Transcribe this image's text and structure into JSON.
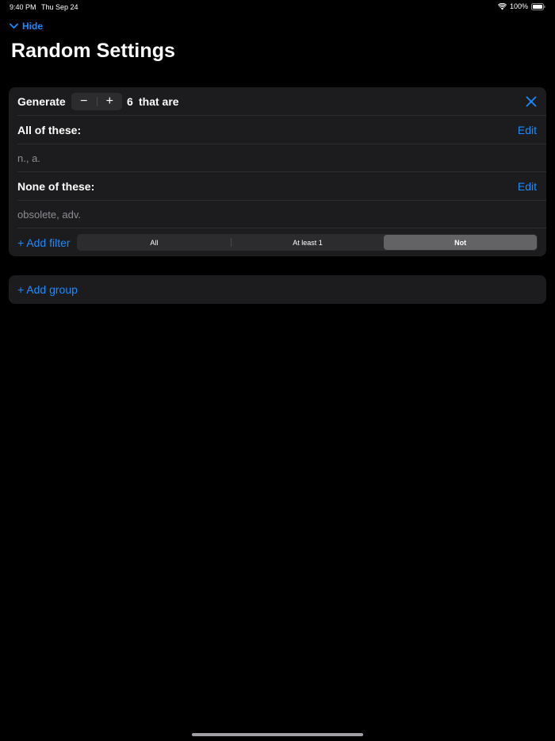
{
  "status_bar": {
    "time": "9:40 PM",
    "date": "Thu Sep 24",
    "battery": "100%"
  },
  "nav": {
    "hide_label": "Hide"
  },
  "page_title": "Random Settings",
  "group": {
    "generate_label": "Generate",
    "stepper_minus": "−",
    "stepper_plus": "+",
    "count": "6",
    "that_are": "that are",
    "all_of_label": "All of these:",
    "all_of_value": "n., a.",
    "none_of_label": "None of these:",
    "none_of_value": "obsolete, adv.",
    "edit_label": "Edit",
    "add_filter_label": "+ Add filter",
    "segments": [
      "All",
      "At least 1",
      "Not"
    ],
    "selected_segment": "Not"
  },
  "add_group_label": "+ Add group",
  "colors": {
    "accent": "#1a8cff",
    "card": "#1c1c1e",
    "background": "#000000",
    "secondary_text": "#8d8d93"
  },
  "icons": {
    "back": "chevron-down-icon",
    "close": "close-icon",
    "wifi": "wifi-icon",
    "battery": "battery-icon"
  }
}
